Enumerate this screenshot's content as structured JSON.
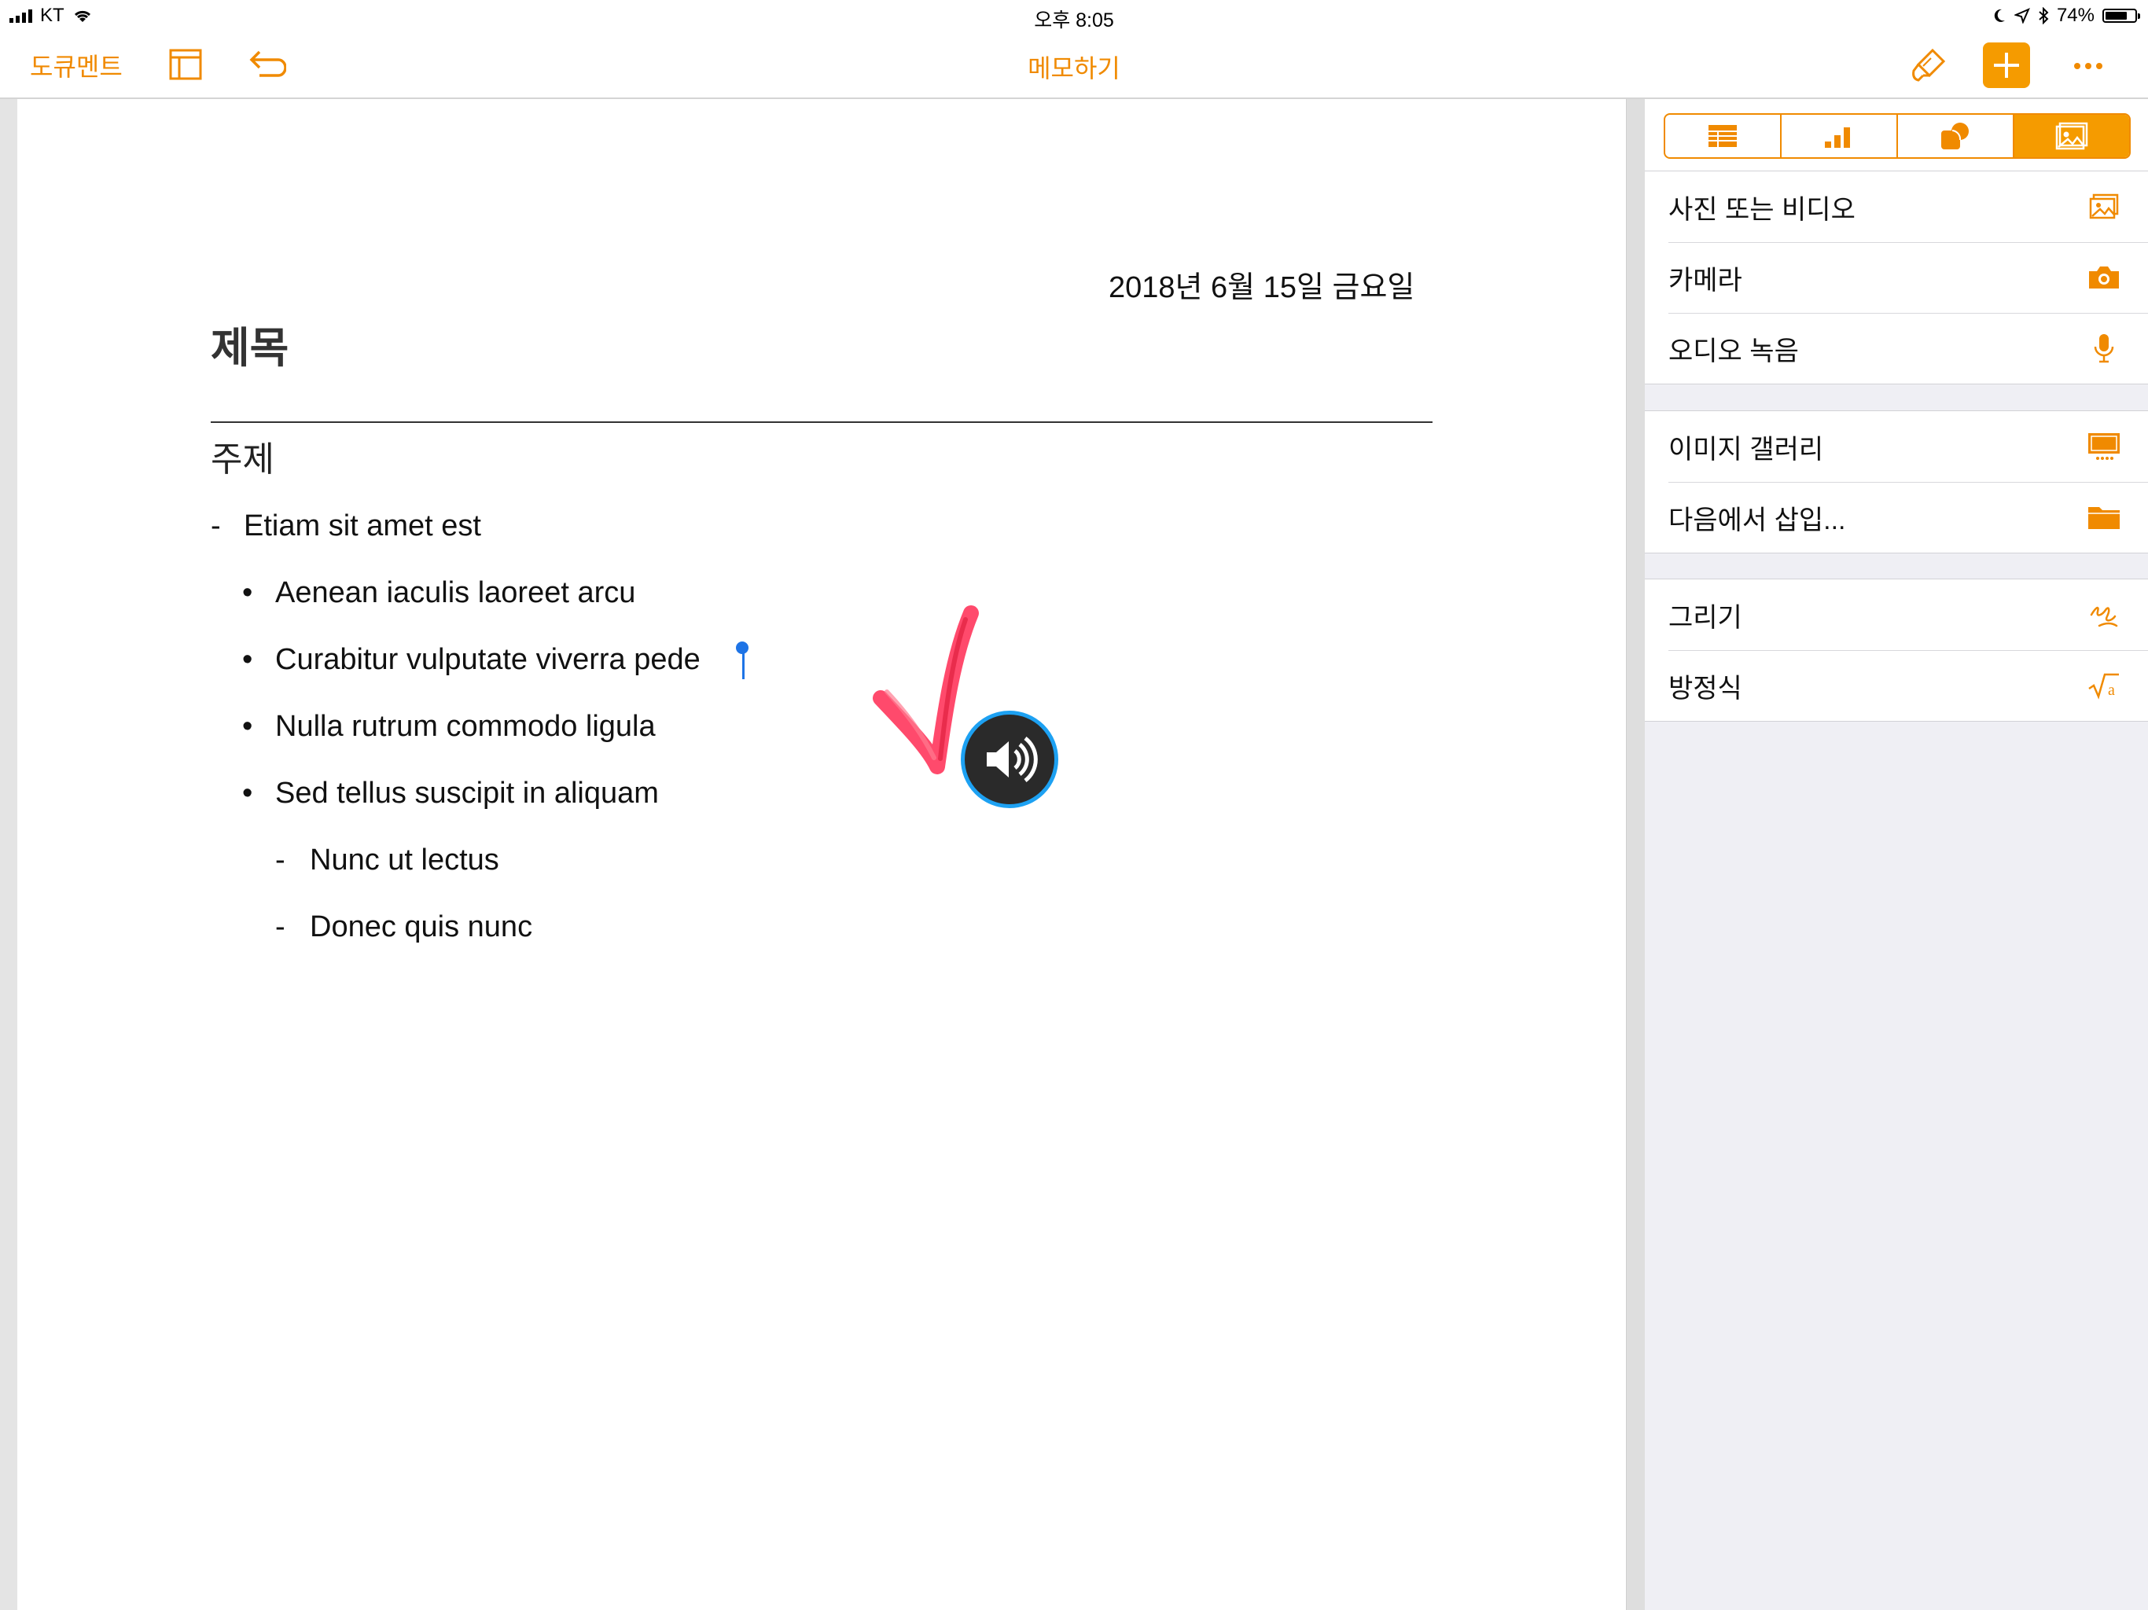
{
  "status_bar": {
    "carrier": "KT",
    "time": "오후 8:05",
    "battery": "74%",
    "battery_level": 0.74
  },
  "toolbar": {
    "documents_label": "도큐멘트",
    "title": "메모하기",
    "icons": [
      "sidebar-view-icon",
      "undo-icon",
      "paintbrush-icon",
      "plus-icon",
      "ellipsis-icon"
    ]
  },
  "document": {
    "date": "2018년 6월 15일 금요일",
    "title": "제목",
    "subtitle": "주제",
    "list": [
      {
        "marker": "-",
        "text": "Etiam sit amet est"
      },
      {
        "marker": "•",
        "text": "Aenean iaculis laoreet arcu"
      },
      {
        "marker": "•",
        "text": "Curabitur vulputate viverra pede"
      },
      {
        "marker": "•",
        "text": "Nulla rutrum commodo ligula"
      },
      {
        "marker": "•",
        "text": "Sed tellus suscipit in aliquam"
      },
      {
        "marker": "-",
        "text": "Nunc ut lectus"
      },
      {
        "marker": "-",
        "text": "Donec quis nunc"
      }
    ]
  },
  "insert_panel": {
    "tabs": [
      "table-icon",
      "chart-icon",
      "shapes-icon",
      "media-icon"
    ],
    "active_tab": "media-icon",
    "groups": [
      [
        {
          "label": "사진 또는 비디오",
          "icon": "photo-icon"
        },
        {
          "label": "카메라",
          "icon": "camera-icon"
        },
        {
          "label": "오디오 녹음",
          "icon": "microphone-icon"
        }
      ],
      [
        {
          "label": "이미지 갤러리",
          "icon": "image-gallery-icon"
        },
        {
          "label": "다음에서 삽입...",
          "icon": "folder-icon"
        }
      ],
      [
        {
          "label": "그리기",
          "icon": "drawing-icon"
        },
        {
          "label": "방정식",
          "icon": "equation-icon"
        }
      ]
    ]
  },
  "colors": {
    "accent": "#f08a00",
    "accent_fill": "#f59b00",
    "stroke_annotation": "#ff3b5f",
    "speaker_ring": "#1da1f2",
    "cursor": "#1e74e6"
  }
}
